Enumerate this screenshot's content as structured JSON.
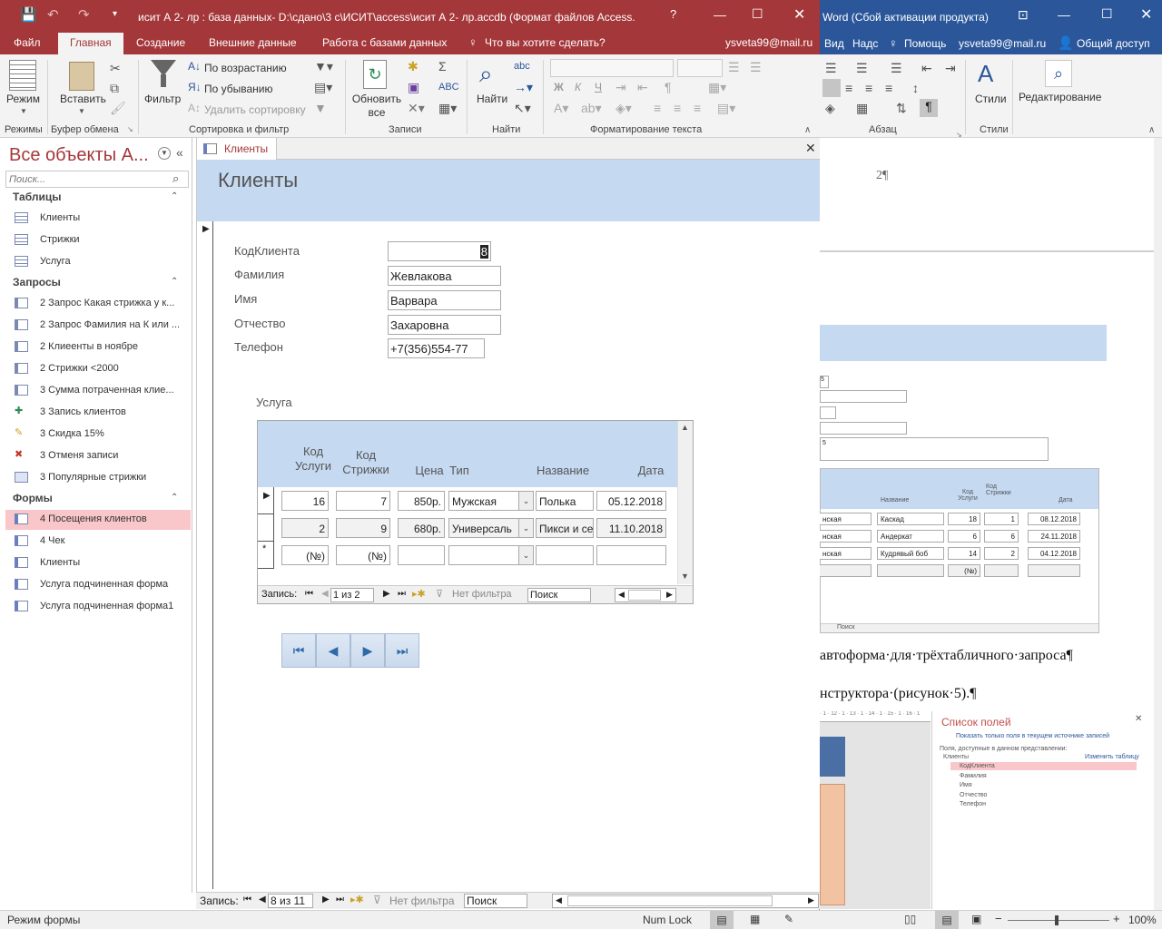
{
  "access": {
    "title": "исит А 2- лр : база данных- D:\\сдано\\3 с\\ИСИТ\\access\\исит А 2- лр.accdb (Формат файлов Access...",
    "tabs": [
      "Файл",
      "Главная",
      "Создание",
      "Внешние данные",
      "Работа с базами данных"
    ],
    "tell_me": "Что вы хотите сделать?",
    "user": "ysveta99@mail.ru",
    "ribbon": {
      "views_label": "Режим",
      "paste_label": "Вставить",
      "filter_label": "Фильтр",
      "sort_asc": "По возрастанию",
      "sort_desc": "По убыванию",
      "remove_sort": "Удалить сортировку",
      "refresh_label": "Обновить все",
      "find_label": "Найти",
      "groups": [
        "Режимы",
        "Буфер обмена",
        "Сортировка и фильтр",
        "Записи",
        "Найти",
        "Форматирование текста"
      ],
      "format_buttons": [
        "Ж",
        "К",
        "Ч"
      ]
    },
    "nav": {
      "title": "Все объекты А...",
      "search_placeholder": "Поиск...",
      "sections": [
        {
          "name": "Таблицы",
          "items": [
            "Клиенты",
            "Стрижки",
            "Услуга"
          ]
        },
        {
          "name": "Запросы",
          "items": [
            "2 Запрос Какая стрижка у к...",
            "2 Запрос Фамилия на К или ...",
            "2 Клиеенты в ноябре",
            "2 Стрижки <2000",
            "3 Сумма потраченная клие...",
            "3 Запись клиентов",
            "3 Скидка 15%",
            "3 Отменя записи",
            "3 Популярные стрижки"
          ]
        },
        {
          "name": "Формы",
          "items": [
            "4 Посещения клиентов",
            "4 Чек",
            "Клиенты",
            "Услуга подчиненная форма",
            "Услуга подчиненная форма1"
          ]
        }
      ]
    },
    "doc_tab": "Клиенты",
    "form": {
      "header": "Клиенты",
      "labels": [
        "КодКлиента",
        "Фамилия",
        "Имя",
        "Отчество",
        "Телефон"
      ],
      "values": [
        "8",
        "Жевлакова",
        "Варвара",
        "Захаровна",
        "+7(356)554-77"
      ],
      "subform_label": "Услуга",
      "sub_headers": [
        "Код Услуги",
        "Код Стрижки",
        "Цена",
        "Тип",
        "Название",
        "Дата"
      ],
      "rows": [
        [
          "16",
          "7",
          "850р.",
          "Мужская",
          "Полька",
          "05.12.2018"
        ],
        [
          "2",
          "9",
          "680р.",
          "Универсаль",
          "Пикси и се",
          "11.10.2018"
        ],
        [
          "(№)",
          "(№)",
          "",
          "",
          "",
          ""
        ]
      ],
      "sub_nav": {
        "label": "Запись:",
        "pos": "1 из 2",
        "filter": "Нет фильтра",
        "search": "Поиск"
      }
    },
    "record_nav": {
      "label": "Запись:",
      "pos": "8 из 11",
      "filter": "Нет фильтра",
      "search": "Поиск"
    },
    "status": "Режим формы",
    "numlock": "Num Lock"
  },
  "word": {
    "title": "Word (Сбой активации продукта)",
    "tabs": [
      "Вид",
      "Надс"
    ],
    "help": "Помощь",
    "user": "ysveta99@mail.ru",
    "share": "Общий доступ",
    "ribbon": {
      "styles": "Стили",
      "editing": "Редактирование",
      "groups": [
        "Абзац",
        "Стили"
      ]
    },
    "page_number": "2¶",
    "line1": "автоформа·для·трёхтабличного·запроса¶",
    "line2": "нструктора·(рисунок·5).¶",
    "zoom": "100%",
    "thumb": {
      "headers": [
        "Название",
        "Код Услуги",
        "Код Стрижки",
        "Дата"
      ],
      "rows": [
        [
          "нская",
          "Каскад",
          "18",
          "1",
          "08.12.2018"
        ],
        [
          "нская",
          "Андеркат",
          "6",
          "6",
          "24.11.2018"
        ],
        [
          "нская",
          "Кудрявый боб",
          "14",
          "2",
          "04.12.2018"
        ],
        [
          "",
          "",
          "(№)",
          "",
          ""
        ]
      ],
      "field_list_title": "Список полей",
      "field_list_link": "Показать только поля в текущем источнике записей",
      "field_list_caption": "Поля, доступные в данном представлении:",
      "field_list_table": "Клиенты",
      "field_list_edit": "Изменить таблицу",
      "fields": [
        "КодКлиента",
        "Фамилия",
        "Имя",
        "Отчество",
        "Телефон"
      ]
    }
  }
}
